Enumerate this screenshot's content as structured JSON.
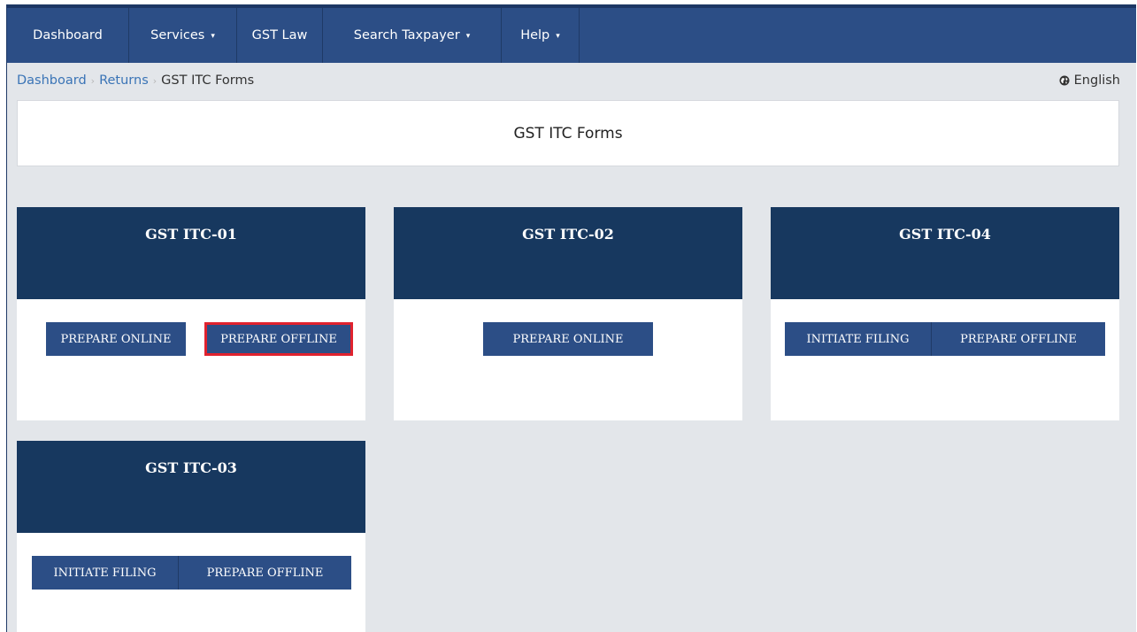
{
  "nav": {
    "items": [
      {
        "label": "Dashboard",
        "dropdown": false
      },
      {
        "label": "Services",
        "dropdown": true
      },
      {
        "label": "GST Law",
        "dropdown": false
      },
      {
        "label": "Search Taxpayer",
        "dropdown": true
      },
      {
        "label": "Help",
        "dropdown": true
      }
    ],
    "caret": "▾"
  },
  "breadcrumb": {
    "items": [
      "Dashboard",
      "Returns",
      "GST ITC Forms"
    ],
    "separator": "›"
  },
  "language": {
    "label": "English",
    "icon": "globe-icon"
  },
  "page_title": "GST ITC Forms",
  "cards": [
    {
      "title": "GST ITC-01",
      "buttons": [
        "PREPARE ONLINE",
        "PREPARE OFFLINE"
      ]
    },
    {
      "title": "GST ITC-02",
      "buttons": [
        "PREPARE ONLINE"
      ]
    },
    {
      "title": "GST ITC-04",
      "buttons": [
        "INITIATE FILING",
        "PREPARE OFFLINE"
      ]
    },
    {
      "title": "GST ITC-03",
      "buttons": [
        "INITIATE FILING",
        "PREPARE OFFLINE"
      ]
    }
  ],
  "colors": {
    "navbar": "#2c4e86",
    "card_header": "#17385f",
    "button": "#2c4e86",
    "highlight": "#e0222e",
    "background": "#e3e6ea",
    "link": "#3a74b6"
  }
}
